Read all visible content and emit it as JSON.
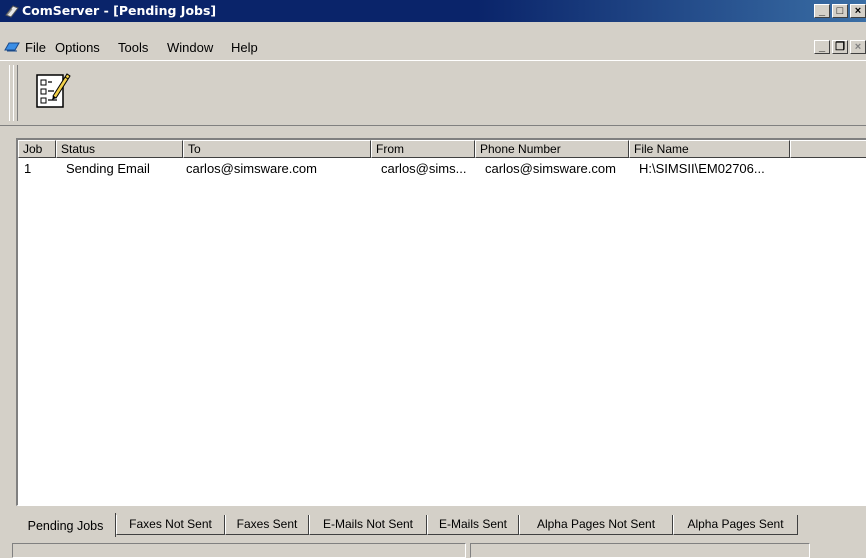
{
  "window": {
    "title": "ComServer - [Pending Jobs]",
    "controls": {
      "minimize": "_",
      "maximize": "□",
      "close": "×"
    },
    "mdi_controls": {
      "minimize": "_",
      "restore": "❐",
      "close": "×"
    }
  },
  "menu": {
    "items": [
      {
        "label": "File"
      },
      {
        "label": "Options"
      },
      {
        "label": "Tools"
      },
      {
        "label": "Window"
      },
      {
        "label": "Help"
      }
    ]
  },
  "toolbar": {
    "buttons": [
      {
        "icon": "checklist-edit-icon"
      }
    ]
  },
  "table": {
    "columns": [
      {
        "label": "Job"
      },
      {
        "label": "Status"
      },
      {
        "label": "To"
      },
      {
        "label": "From"
      },
      {
        "label": "Phone Number"
      },
      {
        "label": "File Name"
      },
      {
        "label": ""
      }
    ],
    "rows": [
      {
        "job": "1",
        "status": "Sending Email",
        "to": "carlos@simsware.com",
        "from": "carlos@sims...",
        "phone": "carlos@simsware.com",
        "file": "H:\\SIMSII\\EM02706..."
      }
    ]
  },
  "tabs": [
    {
      "label": "Pending Jobs",
      "active": true
    },
    {
      "label": "Faxes Not Sent"
    },
    {
      "label": "Faxes Sent"
    },
    {
      "label": "E-Mails Not Sent"
    },
    {
      "label": "E-Mails Sent"
    },
    {
      "label": "Alpha Pages Not Sent"
    },
    {
      "label": "Alpha Pages Sent"
    }
  ],
  "colors": {
    "titlebar": "#0a246a",
    "face": "#d4d0c8"
  }
}
